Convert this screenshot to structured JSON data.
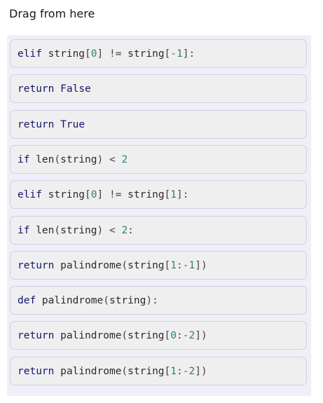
{
  "heading": "Drag from here",
  "blocks": [
    {
      "tokens": [
        {
          "t": "elif",
          "k": "kw"
        },
        {
          "t": " string",
          "k": "name"
        },
        {
          "t": "[",
          "k": "op"
        },
        {
          "t": "0",
          "k": "num"
        },
        {
          "t": "] ",
          "k": "op"
        },
        {
          "t": "!=",
          "k": "op"
        },
        {
          "t": " string",
          "k": "name"
        },
        {
          "t": "[",
          "k": "op"
        },
        {
          "t": "-1",
          "k": "num"
        },
        {
          "t": "]:",
          "k": "op"
        }
      ]
    },
    {
      "tokens": [
        {
          "t": "return",
          "k": "kw"
        },
        {
          "t": " ",
          "k": "name"
        },
        {
          "t": "False",
          "k": "const"
        }
      ]
    },
    {
      "tokens": [
        {
          "t": "return",
          "k": "kw"
        },
        {
          "t": " ",
          "k": "name"
        },
        {
          "t": "True",
          "k": "const"
        }
      ]
    },
    {
      "tokens": [
        {
          "t": "if",
          "k": "kw"
        },
        {
          "t": " len",
          "k": "name"
        },
        {
          "t": "(",
          "k": "op"
        },
        {
          "t": "string",
          "k": "name"
        },
        {
          "t": ") < ",
          "k": "op"
        },
        {
          "t": "2",
          "k": "num"
        }
      ]
    },
    {
      "tokens": [
        {
          "t": "elif",
          "k": "kw"
        },
        {
          "t": " string",
          "k": "name"
        },
        {
          "t": "[",
          "k": "op"
        },
        {
          "t": "0",
          "k": "num"
        },
        {
          "t": "] ",
          "k": "op"
        },
        {
          "t": "!=",
          "k": "op"
        },
        {
          "t": " string",
          "k": "name"
        },
        {
          "t": "[",
          "k": "op"
        },
        {
          "t": "1",
          "k": "num"
        },
        {
          "t": "]:",
          "k": "op"
        }
      ]
    },
    {
      "tokens": [
        {
          "t": "if",
          "k": "kw"
        },
        {
          "t": " len",
          "k": "name"
        },
        {
          "t": "(",
          "k": "op"
        },
        {
          "t": "string",
          "k": "name"
        },
        {
          "t": ") < ",
          "k": "op"
        },
        {
          "t": "2",
          "k": "num"
        },
        {
          "t": ":",
          "k": "op"
        }
      ]
    },
    {
      "tokens": [
        {
          "t": "return",
          "k": "kw"
        },
        {
          "t": " palindrome",
          "k": "name"
        },
        {
          "t": "(",
          "k": "op"
        },
        {
          "t": "string",
          "k": "name"
        },
        {
          "t": "[",
          "k": "op"
        },
        {
          "t": "1",
          "k": "num"
        },
        {
          "t": ":",
          "k": "op"
        },
        {
          "t": "-1",
          "k": "num"
        },
        {
          "t": "])",
          "k": "op"
        }
      ]
    },
    {
      "tokens": [
        {
          "t": "def",
          "k": "kw"
        },
        {
          "t": " palindrome",
          "k": "name"
        },
        {
          "t": "(",
          "k": "op"
        },
        {
          "t": "string",
          "k": "name"
        },
        {
          "t": "):",
          "k": "op"
        }
      ]
    },
    {
      "tokens": [
        {
          "t": "return",
          "k": "kw"
        },
        {
          "t": " palindrome",
          "k": "name"
        },
        {
          "t": "(",
          "k": "op"
        },
        {
          "t": "string",
          "k": "name"
        },
        {
          "t": "[",
          "k": "op"
        },
        {
          "t": "0",
          "k": "num"
        },
        {
          "t": ":",
          "k": "op"
        },
        {
          "t": "-2",
          "k": "num"
        },
        {
          "t": "])",
          "k": "op"
        }
      ]
    },
    {
      "tokens": [
        {
          "t": "return",
          "k": "kw"
        },
        {
          "t": " palindrome",
          "k": "name"
        },
        {
          "t": "(",
          "k": "op"
        },
        {
          "t": "string",
          "k": "name"
        },
        {
          "t": "[",
          "k": "op"
        },
        {
          "t": "1",
          "k": "num"
        },
        {
          "t": ":",
          "k": "op"
        },
        {
          "t": "-2",
          "k": "num"
        },
        {
          "t": "])",
          "k": "op"
        }
      ]
    }
  ]
}
